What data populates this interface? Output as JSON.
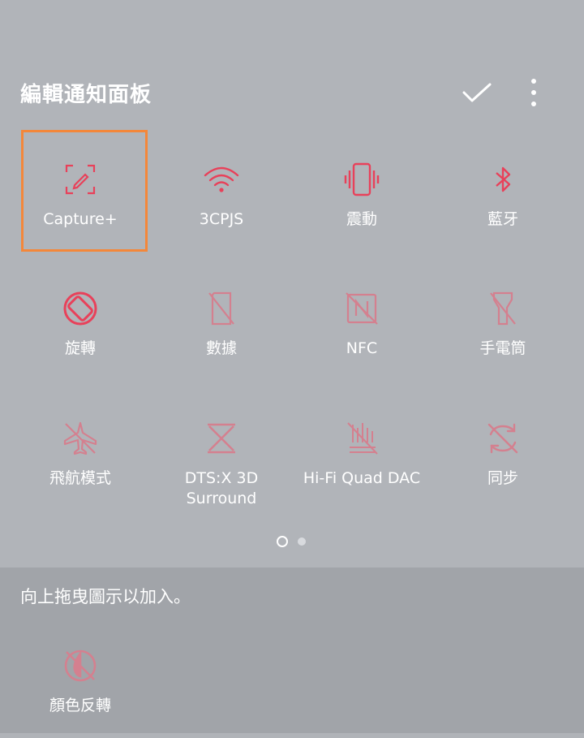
{
  "header": {
    "title": "編輯通知面板"
  },
  "tiles": [
    {
      "label": "Capture+",
      "icon": "capture-plus-icon"
    },
    {
      "label": "3CPJS",
      "icon": "wifi-icon"
    },
    {
      "label": "震動",
      "icon": "vibrate-icon"
    },
    {
      "label": "藍牙",
      "icon": "bluetooth-icon"
    },
    {
      "label": "旋轉",
      "icon": "rotate-icon"
    },
    {
      "label": "數據",
      "icon": "mobile-data-icon"
    },
    {
      "label": "NFC",
      "icon": "nfc-icon"
    },
    {
      "label": "手電筒",
      "icon": "flashlight-icon"
    },
    {
      "label": "飛航模式",
      "icon": "airplane-mode-icon"
    },
    {
      "label": "DTS:X 3D Surround",
      "icon": "dts-icon"
    },
    {
      "label": "Hi-Fi Quad DAC",
      "icon": "hifi-dac-icon"
    },
    {
      "label": "同步",
      "icon": "sync-icon"
    }
  ],
  "pager": {
    "current": 1,
    "total": 2
  },
  "tray": {
    "hint": "向上拖曳圖示以加入。",
    "items": [
      {
        "label": "顏色反轉",
        "icon": "color-invert-icon"
      }
    ]
  },
  "colors": {
    "active": "#e8415a",
    "inactive": "#d4808f",
    "highlight": "#f4873a"
  }
}
